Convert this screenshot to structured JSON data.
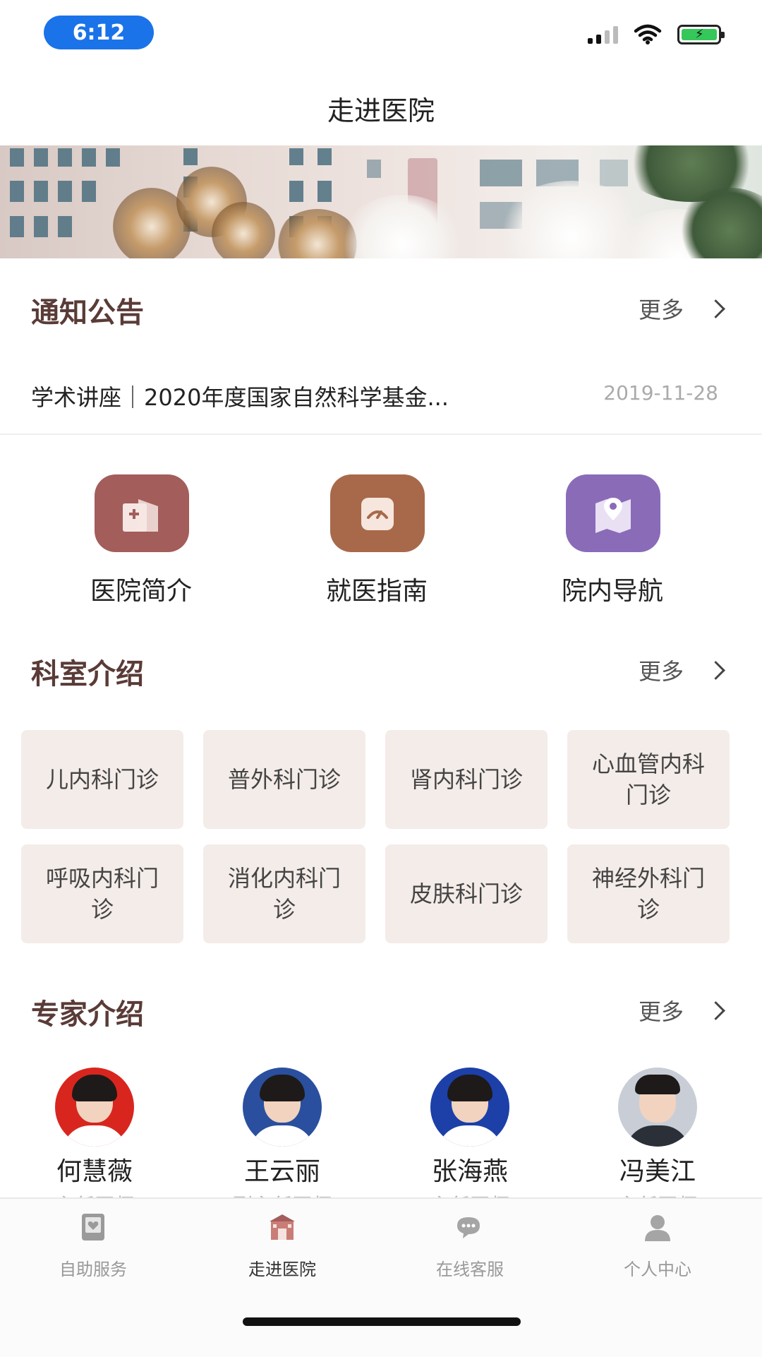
{
  "status_bar": {
    "time": "6:12"
  },
  "header": {
    "title": "走进医院"
  },
  "notice": {
    "section_title": "通知公告",
    "more_label": "更多",
    "items": [
      {
        "text": "学术讲座｜2020年度国家自然科学基金...",
        "date": "2019-11-28"
      }
    ]
  },
  "quick_links": [
    {
      "label": "医院简介",
      "icon": "hospital-icon",
      "color": "#a35d5a"
    },
    {
      "label": "就医指南",
      "icon": "gauge-icon",
      "color": "#a8694a"
    },
    {
      "label": "院内导航",
      "icon": "map-pin-icon",
      "color": "#8a6bb8"
    }
  ],
  "departments": {
    "section_title": "科室介绍",
    "more_label": "更多",
    "items": [
      "儿内科门诊",
      "普外科门诊",
      "肾内科门诊",
      "心血管内科门诊",
      "呼吸内科门诊",
      "消化内科门诊",
      "皮肤科门诊",
      "神经外科门诊"
    ]
  },
  "experts": {
    "section_title": "专家介绍",
    "more_label": "更多",
    "items": [
      {
        "name": "何慧薇",
        "title": "主任医师",
        "bg": "#d8261f"
      },
      {
        "name": "王云丽",
        "title": "副主任医师",
        "bg": "#2a4f9e"
      },
      {
        "name": "张海燕",
        "title": "主任医师",
        "bg": "#1d3fa8"
      },
      {
        "name": "冯美江",
        "title": "主任医师",
        "bg": "#c9ced6"
      }
    ]
  },
  "tab_bar": {
    "active": 1,
    "items": [
      {
        "label": "自助服务",
        "icon": "self-service-icon"
      },
      {
        "label": "走进医院",
        "icon": "hospital-gate-icon"
      },
      {
        "label": "在线客服",
        "icon": "chat-icon"
      },
      {
        "label": "个人中心",
        "icon": "user-icon"
      }
    ]
  },
  "colors": {
    "accent": "#5a3b37",
    "card_bg": "#f4ece9",
    "time_pill": "#1a73e8"
  }
}
